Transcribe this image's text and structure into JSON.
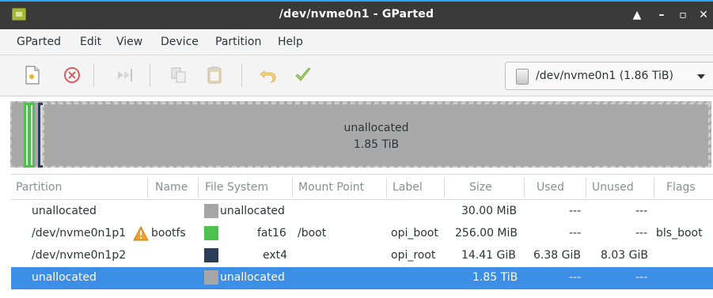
{
  "window": {
    "title": "/dev/nvme0n1 - GParted",
    "controls": {
      "maximize": "▲",
      "minimize": "–",
      "restore": "▫",
      "close": "✕"
    }
  },
  "menu": [
    "GParted",
    "Edit",
    "View",
    "Device",
    "Partition",
    "Help"
  ],
  "toolbar": {
    "icons": [
      "new-icon",
      "delete-icon",
      "resize-move-icon",
      "copy-icon",
      "paste-icon",
      "undo-icon",
      "apply-icon"
    ],
    "device": "/dev/nvme0n1 (1.86 TiB)"
  },
  "disk_map": {
    "segments": [
      {
        "kind": "fat16",
        "color": "#4ec24e"
      },
      {
        "kind": "ext4",
        "color": "#2c3e58"
      }
    ],
    "main_label": "unallocated",
    "main_size": "1.85 TiB"
  },
  "table": {
    "columns": [
      "Partition",
      "Name",
      "File System",
      "Mount Point",
      "Label",
      "Size",
      "Used",
      "Unused",
      "Flags"
    ],
    "rows": [
      {
        "partition": "unallocated",
        "name": "",
        "fs": "unallocated",
        "fs_color": "#a6a6a6",
        "mount": "",
        "label": "",
        "size": "30.00 MiB",
        "used": "---",
        "unused": "---",
        "flags": "",
        "warning": false,
        "selected": false
      },
      {
        "partition": "/dev/nvme0n1p1",
        "name": "bootfs",
        "fs": "fat16",
        "fs_color": "#4ec24e",
        "mount": "/boot",
        "label": "opi_boot",
        "size": "256.00 MiB",
        "used": "---",
        "unused": "---",
        "flags": "bls_boot",
        "warning": true,
        "selected": false
      },
      {
        "partition": "/dev/nvme0n1p2",
        "name": "",
        "fs": "ext4",
        "fs_color": "#2c3e58",
        "mount": "",
        "label": "opi_root",
        "size": "14.41 GiB",
        "used": "6.38 GiB",
        "unused": "8.03 GiB",
        "flags": "",
        "warning": false,
        "selected": false
      },
      {
        "partition": "unallocated",
        "name": "",
        "fs": "unallocated",
        "fs_color": "#a6a6a6",
        "mount": "",
        "label": "",
        "size": "1.85 TiB",
        "used": "---",
        "unused": "---",
        "flags": "",
        "warning": false,
        "selected": true
      }
    ]
  },
  "colors": {
    "accent": "#2aa7f5",
    "selection": "#3d8ee6",
    "titlebar": "#3a3a3a"
  }
}
